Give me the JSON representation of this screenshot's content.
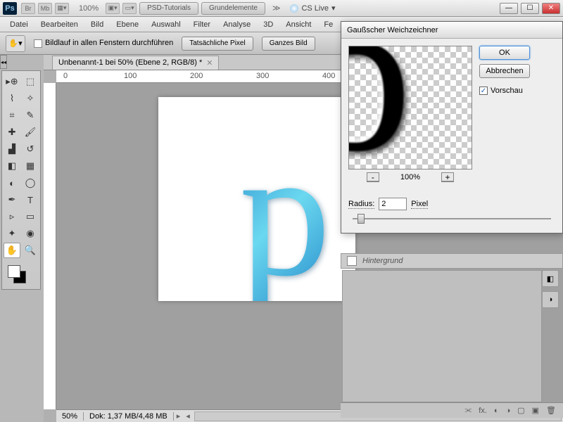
{
  "titlebar": {
    "logo": "Ps",
    "mini1": "Br",
    "mini2": "Mb",
    "zoom": "100%",
    "tab1": "PSD-Tutorials",
    "tab2": "Grundelemente",
    "cslive": "CS Live"
  },
  "menu": [
    "Datei",
    "Bearbeiten",
    "Bild",
    "Ebene",
    "Auswahl",
    "Filter",
    "Analyse",
    "3D",
    "Ansicht",
    "Fe"
  ],
  "options": {
    "scroll_label": "Bildlauf in allen Fenstern durchführen",
    "btn1": "Tatsächliche Pixel",
    "btn2": "Ganzes Bild"
  },
  "document": {
    "tab": "Unbenannt-1 bei 50% (Ebene 2, RGB/8) *",
    "ruler_marks": [
      "0",
      "100",
      "200",
      "300",
      "400"
    ],
    "zoom": "50%",
    "dok": "Dok: 1,37 MB/4,48 MB"
  },
  "dialog": {
    "title": "Gaußscher Weichzeichner",
    "ok": "OK",
    "cancel": "Abbrechen",
    "preview_label": "Vorschau",
    "zoom": "100%",
    "radius_label": "Radius:",
    "radius_value": "2",
    "radius_unit": "Pixel"
  },
  "layers": {
    "bg": "Hintergrund"
  }
}
